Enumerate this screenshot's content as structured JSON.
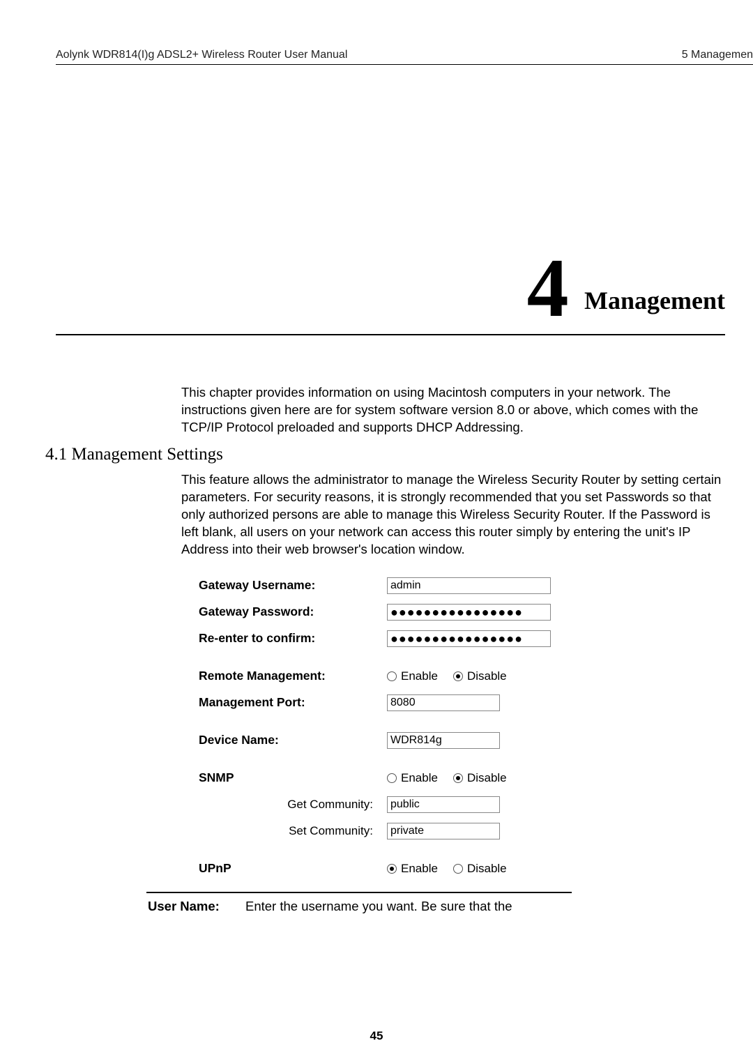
{
  "header": {
    "left": "Aolynk WDR814(I)g ADSL2+ Wireless Router User Manual",
    "right": "5 Managemen"
  },
  "chapter": {
    "number": "4",
    "title": "Management"
  },
  "intro": "This chapter provides information on using Macintosh computers in your network. The instructions given here are for system software version 8.0 or above, which comes with the TCP/IP Protocol preloaded and supports DHCP Addressing.",
  "section": {
    "heading": "4.1  Management Settings",
    "body": "This feature allows the administrator to manage the Wireless Security Router by setting certain parameters. For security reasons, it is strongly recommended that you set Passwords so that only authorized persons are able to manage this Wireless Security Router. If the Password is left blank, all users on your network can access this router simply by entering the unit's IP Address into their web browser's location window."
  },
  "form": {
    "gateway_username": {
      "label": "Gateway Username:",
      "value": "admin"
    },
    "gateway_password": {
      "label": "Gateway Password:",
      "value": "●●●●●●●●●●●●●●●●"
    },
    "reenter": {
      "label": "Re-enter to confirm:",
      "value": "●●●●●●●●●●●●●●●●"
    },
    "remote_mgmt": {
      "label": "Remote Management:",
      "enable": "Enable",
      "disable": "Disable",
      "selected": "disable"
    },
    "mgmt_port": {
      "label": "Management Port:",
      "value": "8080"
    },
    "device_name": {
      "label": "Device Name:",
      "value": "WDR814g"
    },
    "snmp": {
      "label": "SNMP",
      "enable": "Enable",
      "disable": "Disable",
      "selected": "disable",
      "get_label": "Get Community:",
      "get_value": "public",
      "set_label": "Set Community:",
      "set_value": "private"
    },
    "upnp": {
      "label": "UPnP",
      "enable": "Enable",
      "disable": "Disable",
      "selected": "enable"
    }
  },
  "definition": {
    "term": "User Name:",
    "desc": "Enter the username you want. Be sure that the"
  },
  "page_number": "45"
}
